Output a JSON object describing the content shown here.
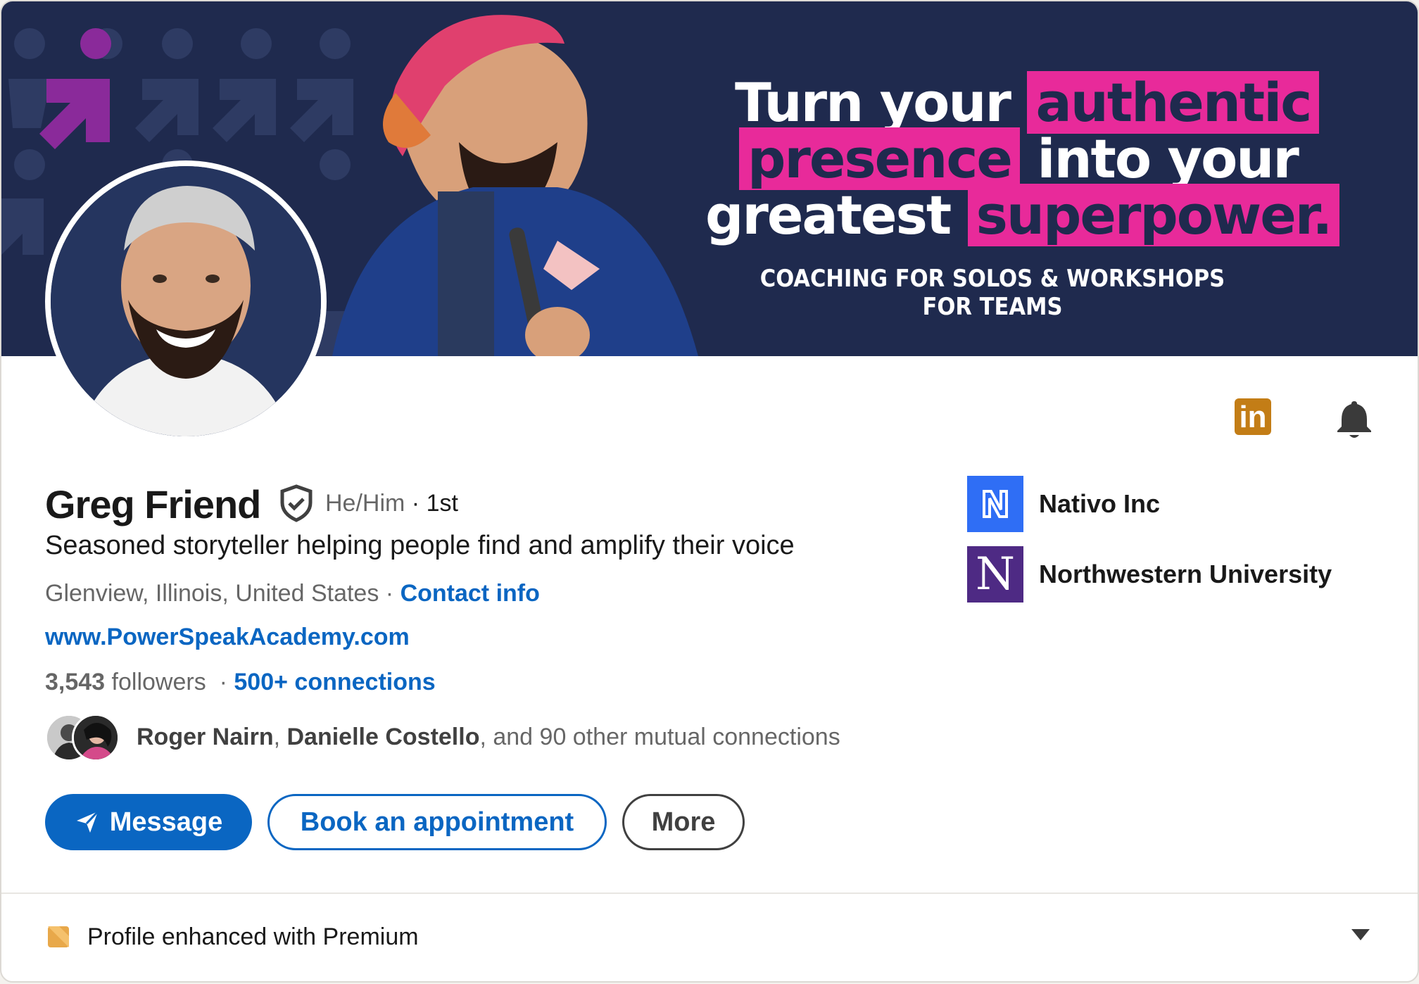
{
  "banner": {
    "headline_white_1": "Turn your",
    "headline_pink_1": "authentic",
    "headline_pink_2": "presence",
    "headline_white_2": "into your",
    "headline_white_3": "greatest",
    "headline_pink_3": "superpower.",
    "subline": "COACHING FOR SOLOS & WORKSHOPS FOR TEAMS",
    "background_color": "#1f2a4e",
    "accent_color": "#e82a9a"
  },
  "profile": {
    "name": "Greg Friend",
    "pronouns": "He/Him",
    "degree": "· 1st",
    "headline": "Seasoned storyteller helping people find and amplify their voice",
    "location": "Glenview, Illinois, United States",
    "location_sep": " · ",
    "contact_info": "Contact info",
    "website": "www.PowerSpeakAcademy.com",
    "followers_count": "3,543",
    "followers_label": " followers",
    "connections_sep": "  · ",
    "connections": "500+ connections",
    "mutual_1": "Roger Nairn",
    "mutual_comma": ", ",
    "mutual_2": "Danielle Costello",
    "mutual_rest": ", and 90 other mutual connections"
  },
  "actions": {
    "message": "Message",
    "book": "Book an appointment",
    "more": "More"
  },
  "orgs": [
    {
      "name": "Nativo Inc",
      "icon": "nativo-logo"
    },
    {
      "name": "Northwestern University",
      "icon": "northwestern-logo",
      "letter": "N"
    }
  ],
  "top_icons": {
    "linkedin_badge": "in",
    "bell": "bell-icon"
  },
  "premium": {
    "text": "Profile enhanced with Premium"
  },
  "colors": {
    "link_blue": "#0a66c2",
    "premium_gold": "#e8a84a",
    "linkedin_badge_gold": "#c37d16",
    "northwestern_purple": "#4e2a84",
    "nativo_blue": "#2f6ef5"
  }
}
